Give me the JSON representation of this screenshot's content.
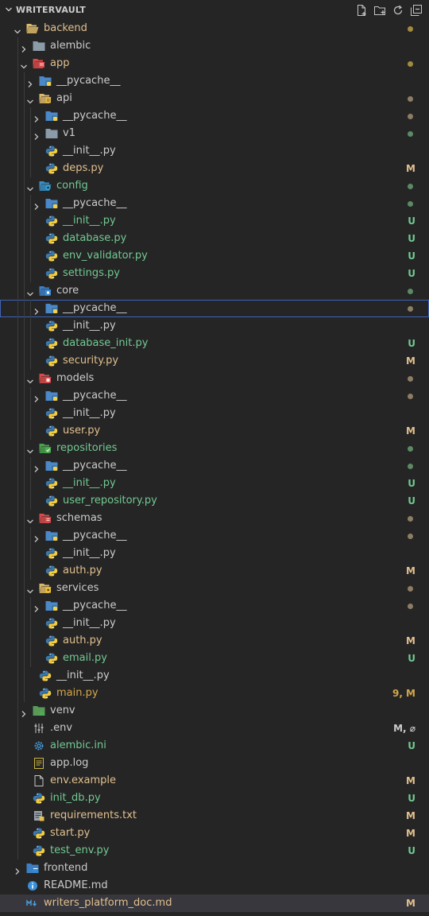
{
  "explorer": {
    "title": "WRITERVAULT",
    "actions": [
      {
        "name": "new-file-icon"
      },
      {
        "name": "new-folder-icon"
      },
      {
        "name": "refresh-icon"
      },
      {
        "name": "collapse-all-icon"
      }
    ]
  },
  "colors": {
    "modified": "#e2c08d",
    "untracked": "#73c991",
    "default": "#cccccc",
    "focus_border": "#3e63b8",
    "selected_bg": "#37373d"
  },
  "tree": [
    {
      "label": "backend",
      "depth": 0,
      "type": "folder",
      "expanded": true,
      "icon": "folder-open-icon",
      "color": "mod",
      "dot": "#a28a3e"
    },
    {
      "label": "alembic",
      "depth": 1,
      "type": "folder",
      "expanded": false,
      "icon": "folder-icon",
      "color": "def"
    },
    {
      "label": "app",
      "depth": 1,
      "type": "folder",
      "expanded": true,
      "icon": "folder-app-icon",
      "color": "mod",
      "dot": "#a28a3e"
    },
    {
      "label": "__pycache__",
      "depth": 2,
      "type": "folder",
      "expanded": false,
      "icon": "folder-python-icon",
      "color": "def"
    },
    {
      "label": "api",
      "depth": 2,
      "type": "folder",
      "expanded": true,
      "icon": "folder-api-icon",
      "color": "def",
      "dot": "#8d7d63"
    },
    {
      "label": "__pycache__",
      "depth": 3,
      "type": "folder",
      "expanded": false,
      "icon": "folder-python-icon",
      "color": "def",
      "dot": "#8d7d63"
    },
    {
      "label": "v1",
      "depth": 3,
      "type": "folder",
      "expanded": false,
      "icon": "folder-icon",
      "color": "def",
      "dot": "#5b8a63"
    },
    {
      "label": "__init__.py",
      "depth": 3,
      "type": "file",
      "icon": "python-icon",
      "color": "def"
    },
    {
      "label": "deps.py",
      "depth": 3,
      "type": "file",
      "icon": "python-icon",
      "color": "mod",
      "badge": "M"
    },
    {
      "label": "config",
      "depth": 2,
      "type": "folder",
      "expanded": true,
      "icon": "folder-config-icon",
      "color": "untr",
      "dot": "#5b8a63"
    },
    {
      "label": "__pycache__",
      "depth": 3,
      "type": "folder",
      "expanded": false,
      "icon": "folder-python-icon",
      "color": "def",
      "dot": "#5b8a63"
    },
    {
      "label": "__init__.py",
      "depth": 3,
      "type": "file",
      "icon": "python-icon",
      "color": "untr",
      "badge": "U"
    },
    {
      "label": "database.py",
      "depth": 3,
      "type": "file",
      "icon": "python-icon",
      "color": "untr",
      "badge": "U"
    },
    {
      "label": "env_validator.py",
      "depth": 3,
      "type": "file",
      "icon": "python-icon",
      "color": "untr",
      "badge": "U"
    },
    {
      "label": "settings.py",
      "depth": 3,
      "type": "file",
      "icon": "python-icon",
      "color": "untr",
      "badge": "U"
    },
    {
      "label": "core",
      "depth": 2,
      "type": "folder",
      "expanded": true,
      "icon": "folder-core-icon",
      "color": "def",
      "dot": "#5b8a63"
    },
    {
      "label": "__pycache__",
      "depth": 3,
      "type": "folder",
      "expanded": false,
      "icon": "folder-python-icon",
      "color": "def",
      "dot": "#8d7d63",
      "focused": true
    },
    {
      "label": "__init__.py",
      "depth": 3,
      "type": "file",
      "icon": "python-icon",
      "color": "def"
    },
    {
      "label": "database_init.py",
      "depth": 3,
      "type": "file",
      "icon": "python-icon",
      "color": "untr",
      "badge": "U"
    },
    {
      "label": "security.py",
      "depth": 3,
      "type": "file",
      "icon": "python-icon",
      "color": "mod",
      "badge": "M"
    },
    {
      "label": "models",
      "depth": 2,
      "type": "folder",
      "expanded": true,
      "icon": "folder-models-icon",
      "color": "def",
      "dot": "#8d7d63"
    },
    {
      "label": "__pycache__",
      "depth": 3,
      "type": "folder",
      "expanded": false,
      "icon": "folder-python-icon",
      "color": "def",
      "dot": "#8d7d63"
    },
    {
      "label": "__init__.py",
      "depth": 3,
      "type": "file",
      "icon": "python-icon",
      "color": "def"
    },
    {
      "label": "user.py",
      "depth": 3,
      "type": "file",
      "icon": "python-icon",
      "color": "mod",
      "badge": "M"
    },
    {
      "label": "repositories",
      "depth": 2,
      "type": "folder",
      "expanded": true,
      "icon": "folder-repositories-icon",
      "color": "untr",
      "dot": "#5b8a63"
    },
    {
      "label": "__pycache__",
      "depth": 3,
      "type": "folder",
      "expanded": false,
      "icon": "folder-python-icon",
      "color": "def",
      "dot": "#5b8a63"
    },
    {
      "label": "__init__.py",
      "depth": 3,
      "type": "file",
      "icon": "python-icon",
      "color": "untr",
      "badge": "U"
    },
    {
      "label": "user_repository.py",
      "depth": 3,
      "type": "file",
      "icon": "python-icon",
      "color": "untr",
      "badge": "U"
    },
    {
      "label": "schemas",
      "depth": 2,
      "type": "folder",
      "expanded": true,
      "icon": "folder-schemas-icon",
      "color": "def",
      "dot": "#8d7d63"
    },
    {
      "label": "__pycache__",
      "depth": 3,
      "type": "folder",
      "expanded": false,
      "icon": "folder-python-icon",
      "color": "def",
      "dot": "#8d7d63"
    },
    {
      "label": "__init__.py",
      "depth": 3,
      "type": "file",
      "icon": "python-icon",
      "color": "def"
    },
    {
      "label": "auth.py",
      "depth": 3,
      "type": "file",
      "icon": "python-icon",
      "color": "mod",
      "badge": "M"
    },
    {
      "label": "services",
      "depth": 2,
      "type": "folder",
      "expanded": true,
      "icon": "folder-services-icon",
      "color": "def",
      "dot": "#8d7d63"
    },
    {
      "label": "__pycache__",
      "depth": 3,
      "type": "folder",
      "expanded": false,
      "icon": "folder-python-icon",
      "color": "def",
      "dot": "#8d7d63"
    },
    {
      "label": "__init__.py",
      "depth": 3,
      "type": "file",
      "icon": "python-icon",
      "color": "def"
    },
    {
      "label": "auth.py",
      "depth": 3,
      "type": "file",
      "icon": "python-icon",
      "color": "mod",
      "badge": "M"
    },
    {
      "label": "email.py",
      "depth": 3,
      "type": "file",
      "icon": "python-icon",
      "color": "untr",
      "badge": "U"
    },
    {
      "label": "__init__.py",
      "depth": 2,
      "type": "file",
      "icon": "python-icon",
      "color": "def"
    },
    {
      "label": "main.py",
      "depth": 2,
      "type": "file",
      "icon": "python-icon",
      "color": "err",
      "badge": "9, M"
    },
    {
      "label": "venv",
      "depth": 1,
      "type": "folder",
      "expanded": false,
      "icon": "folder-venv-icon",
      "color": "def"
    },
    {
      "label": ".env",
      "depth": 1,
      "type": "file",
      "icon": "env-settings-icon",
      "color": "def",
      "badge": "M, ⌀"
    },
    {
      "label": "alembic.ini",
      "depth": 1,
      "type": "file",
      "icon": "gear-icon",
      "color": "untr",
      "badge": "U"
    },
    {
      "label": "app.log",
      "depth": 1,
      "type": "file",
      "icon": "log-icon",
      "color": "def"
    },
    {
      "label": "env.example",
      "depth": 1,
      "type": "file",
      "icon": "file-icon",
      "color": "mod",
      "badge": "M"
    },
    {
      "label": "init_db.py",
      "depth": 1,
      "type": "file",
      "icon": "python-icon",
      "color": "untr",
      "badge": "U"
    },
    {
      "label": "requirements.txt",
      "depth": 1,
      "type": "file",
      "icon": "requirements-icon",
      "color": "mod",
      "badge": "M"
    },
    {
      "label": "start.py",
      "depth": 1,
      "type": "file",
      "icon": "python-icon",
      "color": "mod",
      "badge": "M"
    },
    {
      "label": "test_env.py",
      "depth": 1,
      "type": "file",
      "icon": "python-icon",
      "color": "untr",
      "badge": "U"
    },
    {
      "label": "frontend",
      "depth": 0,
      "type": "folder",
      "expanded": false,
      "icon": "folder-frontend-icon",
      "color": "def"
    },
    {
      "label": "README.md",
      "depth": 0,
      "type": "file",
      "icon": "info-icon",
      "color": "def"
    },
    {
      "label": "writers_platform_doc.md",
      "depth": 0,
      "type": "file",
      "icon": "markdown-icon",
      "color": "mod",
      "badge": "M",
      "selected": true
    }
  ]
}
